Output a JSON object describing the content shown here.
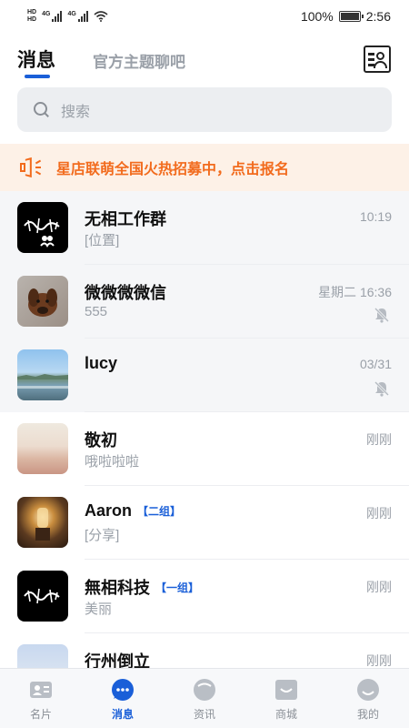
{
  "status_bar": {
    "hd_top": "HD",
    "hd_bottom": "HD",
    "network1": "4G",
    "network2": "4G",
    "battery": "100%",
    "time": "2:56"
  },
  "header": {
    "tab_messages": "消息",
    "tab_official": "官方主题聊吧"
  },
  "search": {
    "placeholder": "搜索"
  },
  "banner": {
    "text": "星店联萌全国火热招募中，点击报名"
  },
  "conversations": [
    {
      "name": "无相工作群",
      "tag": "",
      "preview": "[位置]",
      "time": "10:19",
      "muted": false,
      "pinned": true,
      "avatar": "logo-avatar"
    },
    {
      "name": "微微微微信",
      "tag": "",
      "preview": "555",
      "time": "星期二 16:36",
      "muted": true,
      "pinned": true,
      "avatar": "dog-photo-avatar"
    },
    {
      "name": "lucy",
      "tag": "",
      "preview": "",
      "time": "03/31",
      "muted": true,
      "pinned": true,
      "avatar": "lake-photo-avatar"
    },
    {
      "name": "敬初",
      "tag": "",
      "preview": "哦啦啦啦",
      "time": "刚刚",
      "muted": false,
      "pinned": false,
      "avatar": "desert-photo-avatar"
    },
    {
      "name": "Aaron",
      "tag": "【二组】",
      "preview": "[分享]",
      "time": "刚刚",
      "muted": false,
      "pinned": false,
      "avatar": "lamp-photo-avatar"
    },
    {
      "name": "無相科技",
      "tag": "【一组】",
      "preview": "美丽",
      "time": "刚刚",
      "muted": false,
      "pinned": false,
      "avatar": "logo-avatar"
    },
    {
      "name": "行州倒立",
      "tag": "",
      "preview": "",
      "time": "刚刚",
      "muted": false,
      "pinned": false,
      "avatar": "city-photo-avatar"
    }
  ],
  "bottom_nav": [
    {
      "label": "名片",
      "icon": "card-icon",
      "active": false
    },
    {
      "label": "消息",
      "icon": "chat-bubble-icon",
      "active": true
    },
    {
      "label": "资讯",
      "icon": "news-icon",
      "active": false
    },
    {
      "label": "商城",
      "icon": "shop-icon",
      "active": false
    },
    {
      "label": "我的",
      "icon": "profile-icon",
      "active": false
    }
  ],
  "colors": {
    "accent": "#1a5fd8",
    "banner_text": "#f26b1d",
    "banner_bg": "#fdf1e7",
    "muted_text": "#9aa0a8"
  }
}
